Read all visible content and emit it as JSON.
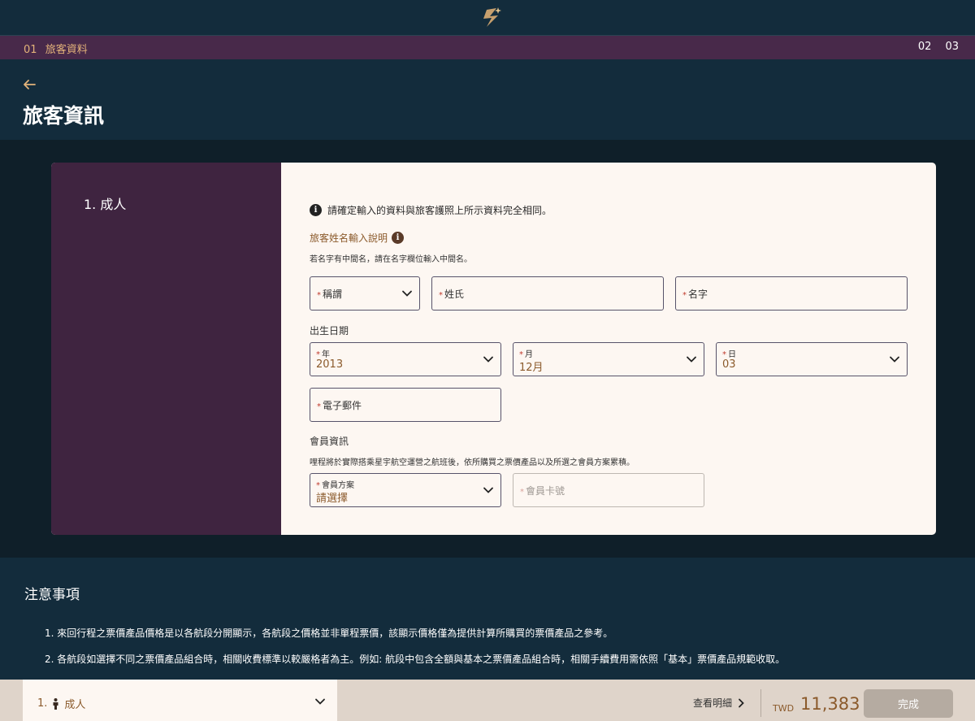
{
  "progress": {
    "current_step_number": "01",
    "current_step_label": "旅客資料",
    "other_steps": [
      "02",
      "03"
    ]
  },
  "header": {
    "title": "旅客資訊"
  },
  "passenger": {
    "label": "1. 成人",
    "notice": "請確定輸入的資料與旅客護照上所示資料完全相同。",
    "name_help_title": "旅客姓名輸入說明",
    "name_help_hint": "若名字有中間名，請在名字欄位輸入中間名。",
    "title_field_label": "稱謂",
    "surname_label": "姓氏",
    "given_name_label": "名字",
    "birth_section": "出生日期",
    "year_label": "年",
    "year_value": "2013",
    "month_label": "月",
    "month_value": "12月",
    "day_label": "日",
    "day_value": "03",
    "email_label": "電子郵件",
    "member_section": "會員資訊",
    "member_hint": "哩程將於實際搭乘星宇航空運營之航班後，依所購買之票價產品以及所選之會員方案累積。",
    "member_plan_label": "會員方案",
    "member_plan_value": "請選擇",
    "member_card_placeholder": "會員卡號",
    "required_mark": "*"
  },
  "notes": {
    "title": "注意事項",
    "items": [
      "1. 來回行程之票價產品價格是以各航段分開顯示，各航段之價格並非單程票價，該顯示價格僅為提供計算所購買的票價產品之參考。",
      "2. 各航段如選擇不同之票價產品組合時，相關收費標準以較嚴格者為主。例如: 航段中包含全額與基本之票價產品組合時，相關手續費用需依照「基本」票價產品規範收取。"
    ]
  },
  "footer": {
    "pax_number": "1.",
    "pax_type": "成人",
    "details_label": "查看明細",
    "currency": "TWD",
    "total": "11,383",
    "done_label": "完成"
  },
  "colors": {
    "accent_gold": "#e3b37a",
    "brown_text": "#8b5a2b",
    "plum": "#48294a",
    "navy": "#132c3c"
  },
  "icons": [
    "starlux-logo-icon",
    "back-arrow-icon",
    "info-icon",
    "chevron-down-icon",
    "person-icon",
    "chevron-right-icon"
  ]
}
